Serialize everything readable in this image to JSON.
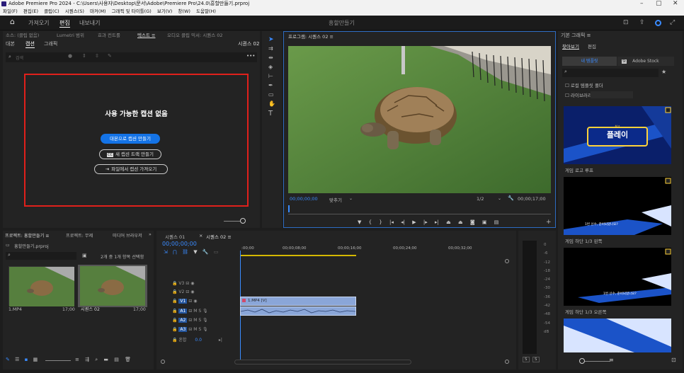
{
  "window": {
    "title": "Adobe Premiere Pro 2024 - C:\\Users\\사용자\\Desktop\\문서\\Adobe\\Premiere Pro\\24.0\\흥할만들기.prproj",
    "min": "–",
    "max": "▢",
    "close": "✕"
  },
  "menu": [
    "파일(F)",
    "편집(E)",
    "클립(C)",
    "시퀀스(S)",
    "마커(M)",
    "그래픽 및 타이틀(G)",
    "보기(V)",
    "창(W)",
    "도움말(H)"
  ],
  "topbar": {
    "home": "⌂",
    "tabs": [
      "가져오기",
      "편집",
      "내보내기"
    ],
    "project_title": "흥할만들기"
  },
  "source_panel": {
    "tabs": [
      "소스: (클립 없음)",
      "Lumetri 범위",
      "효과 컨트롤",
      "텍스트 ≡",
      "오디오 클립 믹서: 시퀀스 02"
    ],
    "subtabs": [
      "대본",
      "캡션",
      "그래픽"
    ],
    "seq_label": "시퀀스 02",
    "search_placeholder": "검색",
    "more": "•••"
  },
  "captions": {
    "title": "사용 가능한 캡션 없음",
    "btn_transcript": "대본으로 캡션 만들기",
    "btn_new_track": "새 캡션 트랙 만들기",
    "btn_import": "파일에서 캡션 가져오기",
    "cc": "CC"
  },
  "program": {
    "tab": "프로그램: 시퀀스 02 ≡",
    "timecode_in": "00;00;00;00",
    "fit": "맞추기",
    "quality": "1/2",
    "duration": "00;00;17;00"
  },
  "essential": {
    "title": "기본 그래픽 ≡",
    "tabs": [
      "찾아보기",
      "편집"
    ],
    "btn_my": "내 템플릿",
    "btn_stock": "Adobe Stock",
    "search": "",
    "check1": "로컬 템플릿 폴더",
    "check2": "라이브러리",
    "cards": [
      {
        "label": "게임 로고 루프",
        "text": "플레이",
        "small": "최고"
      },
      {
        "label": "게임 하단 1/3 왼쪽",
        "text": "1번 선수, 준비되었나요?"
      },
      {
        "label": "게임 하단 1/3 오른쪽",
        "text": "1번 선수, 준비되었나요?"
      }
    ]
  },
  "project": {
    "tabs": [
      "프로젝트: 흥할만들기 ≡",
      "프로젝트: 무제",
      "미디어 브라우저"
    ],
    "folder": "흥할만들기.prproj",
    "count": "2개 중 1개 항목 선택함",
    "items": [
      {
        "name": "1.MP4",
        "dur": "17;00"
      },
      {
        "name": "시퀀스 02",
        "dur": "17;00"
      }
    ]
  },
  "timeline": {
    "tabs": [
      "시퀀스 01",
      "시퀀스 02 ≡"
    ],
    "timecode": "00;00;00;00",
    "ruler": [
      ":00;00",
      "00;00;08;00",
      "00;00;16;00",
      "00;00;24;00",
      "00;00;32;00"
    ],
    "tracks": [
      "V3",
      "V2",
      "V1",
      "A1",
      "A2",
      "A3"
    ],
    "mix": "혼합",
    "mix_val": "0.0",
    "clip": "1.MP4 [V]"
  },
  "meter": {
    "labels": [
      "0",
      "-6",
      "-12",
      "-18",
      "-24",
      "-30",
      "-36",
      "-42",
      "-48",
      "-54",
      "dB"
    ],
    "s1": "S",
    "s2": "S"
  }
}
